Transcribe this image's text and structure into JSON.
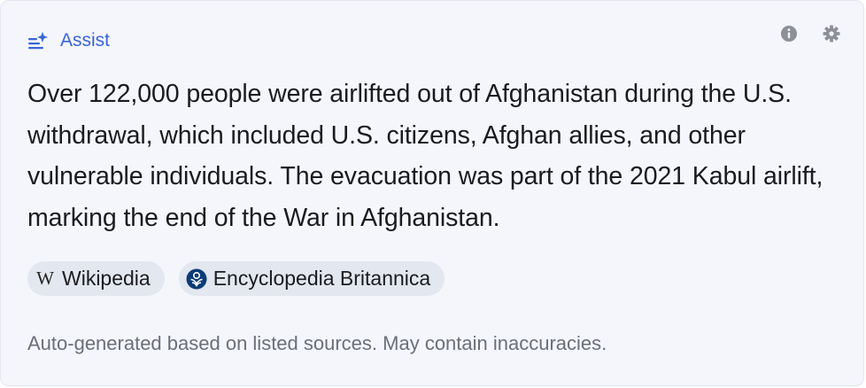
{
  "header": {
    "title": "Assist",
    "icon": "sparkle-list-icon",
    "accent_color": "#3a64d8",
    "actions": [
      {
        "name": "info-icon"
      },
      {
        "name": "gear-icon"
      }
    ]
  },
  "answer": {
    "text": "Over 122,000 people were airlifted out of Afghanistan during the U.S. withdrawal, which included U.S. citizens, Afghan allies, and other vulnerable individuals. The evacuation was part of the 2021 Kabul airlift, marking the end of the War in Afghanistan."
  },
  "sources": [
    {
      "label": "Wikipedia",
      "icon": "wikipedia-icon",
      "glyph": "W"
    },
    {
      "label": "Encyclopedia Britannica",
      "icon": "britannica-icon"
    }
  ],
  "footer": {
    "disclaimer": "Auto-generated based on listed sources. May contain inaccuracies."
  }
}
